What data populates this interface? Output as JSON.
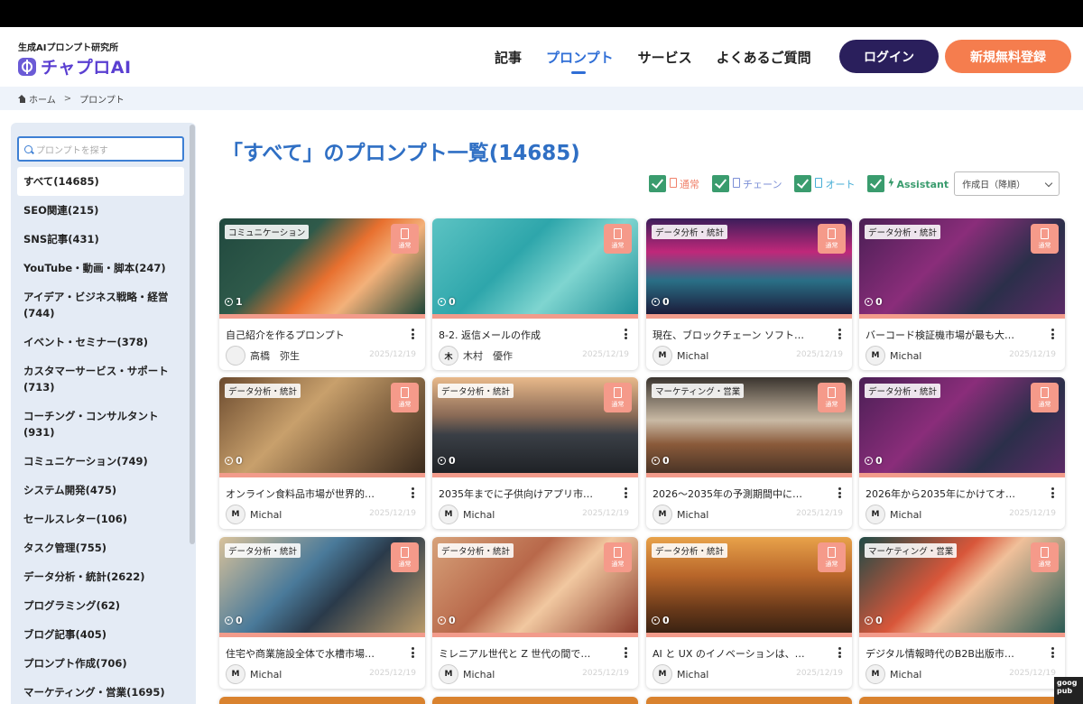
{
  "header": {
    "logo_sub": "生成AIプロンプト研究所",
    "logo_main": "チャプロAI",
    "nav": [
      "記事",
      "プロンプト",
      "サービス",
      "よくあるご質問"
    ],
    "nav_active_index": 1,
    "login_label": "ログイン",
    "register_label": "新規無料登録"
  },
  "breadcrumb": {
    "home": "ホーム",
    "separator": ">",
    "current": "プロンプト"
  },
  "sidebar": {
    "search_placeholder": "プロンプトを探す",
    "categories": [
      "すべて(14685)",
      "SEO関連(215)",
      "SNS記事(431)",
      "YouTube・動画・脚本(247)",
      "アイデア・ビジネス戦略・経営(744)",
      "イベント・セミナー(378)",
      "カスタマーサービス・サポート(713)",
      "コーチング・コンサルタント(931)",
      "コミュニケーション(749)",
      "システム開発(475)",
      "セールスレター(106)",
      "タスク管理(755)",
      "データ分析・統計(2622)",
      "プログラミング(62)",
      "ブログ記事(405)",
      "プロンプト作成(706)",
      "マーケティング・営業(1695)"
    ],
    "active_index": 0
  },
  "main": {
    "title": "「すべて」のプロンプト一覧(14685)",
    "filters": {
      "normal": "通常",
      "chain": "チェーン",
      "auto": "オート",
      "assistant": "Assistant",
      "sort_selected": "作成日（降順）"
    },
    "badge_label": "通常",
    "cards": [
      {
        "category": "コミュニケーション",
        "views": "1",
        "title": "自己紹介を作るプロンプト",
        "author": "高橋　弥生",
        "avatar": "",
        "date": "2025/12/19",
        "bg": "linear-gradient(135deg,#20483e 0%,#2f5a4a 35%,#e8702f 55%,#f3b17a 70%,#1f4537 100%)"
      },
      {
        "category": "",
        "views": "0",
        "title": "8-2. 返信メールの作成",
        "author": "木村　優作",
        "avatar": "木",
        "date": "2025/12/19",
        "bg": "linear-gradient(135deg,#5cc3c3 0%,#2ea6ab 40%,#7fd5d0 65%,#1f8f98 100%)"
      },
      {
        "category": "データ分析・統計",
        "views": "0",
        "title": "現在、ブロックチェーン ソフトウェ…",
        "author": "Michal",
        "avatar": "M",
        "date": "2025/12/19",
        "bg": "linear-gradient(180deg,#3b1d5a 0%,#c0287a 35%,#2a6f86 65%,#1b1b3a 100%)"
      },
      {
        "category": "データ分析・統計",
        "views": "0",
        "title": "バーコード検証機市場が最も大きな…",
        "author": "Michal",
        "avatar": "M",
        "date": "2025/12/19",
        "bg": "linear-gradient(135deg,#4a1f55 0%,#8a2d7a 40%,#2b2f4a 70%,#5b2a66 100%)"
      },
      {
        "category": "データ分析・統計",
        "views": "0",
        "title": "オンライン食料品市場が世界的に日…",
        "author": "Michal",
        "avatar": "M",
        "date": "2025/12/19",
        "bg": "linear-gradient(135deg,#6b4a2e 0%,#c8a06c 40%,#8a6a46 65%,#3a2a1c 100%)"
      },
      {
        "category": "データ分析・統計",
        "views": "0",
        "title": "2035年までに子供向けアプリ市場…",
        "author": "Michal",
        "avatar": "M",
        "date": "2025/12/19",
        "bg": "linear-gradient(180deg,#e8b98a 0%,#8a6a56 40%,#3a3f46 60%,#1f2226 100%)"
      },
      {
        "category": "マーケティング・営業",
        "views": "0",
        "title": "2026〜2035年の予測期間中に高級…",
        "author": "Michal",
        "avatar": "M",
        "date": "2025/12/19",
        "bg": "linear-gradient(180deg,#3a342e 0%,#c9b9a4 45%,#8a5a3a 70%,#4a3426 100%)"
      },
      {
        "category": "データ分析・統計",
        "views": "0",
        "title": "2026年から2035年にかけてオンラ…",
        "author": "Michal",
        "avatar": "M",
        "date": "2025/12/19",
        "bg": "linear-gradient(135deg,#4a1f55 0%,#8a2d7a 40%,#2b2f4a 70%,#5b2a66 100%)"
      },
      {
        "category": "データ分析・統計",
        "views": "0",
        "title": "住宅や商業施設全体で水槽市場が急…",
        "author": "Michal",
        "avatar": "M",
        "date": "2025/12/19",
        "bg": "linear-gradient(135deg,#d9c29a 0%,#4a7a9a 40%,#2a3a4a 60%,#b89a6a 100%)"
      },
      {
        "category": "データ分析・統計",
        "views": "0",
        "title": "ミレニアル世代と Z 世代の間でキャ…",
        "author": "Michal",
        "avatar": "M",
        "date": "2025/12/19",
        "bg": "linear-gradient(135deg,#d7a27a 0%,#b8684a 40%,#f1c8a0 60%,#8a3a2a 100%)"
      },
      {
        "category": "データ分析・統計",
        "views": "0",
        "title": "AI と UX のイノベーションは、ユー…",
        "author": "Michal",
        "avatar": "M",
        "date": "2025/12/19",
        "bg": "linear-gradient(180deg,#e8a24a 0%,#b8662a 40%,#6a3a1a 75%,#3a2212 100%)"
      },
      {
        "category": "マーケティング・営業",
        "views": "0",
        "title": "デジタル情報時代のB2B出版市場は…",
        "author": "Michal",
        "avatar": "M",
        "date": "2025/12/19",
        "bg": "linear-gradient(135deg,#1f4a46 0%,#d8563a 40%,#f0c09a 55%,#2a5a54 100%)"
      }
    ]
  },
  "ad_text": "goog pub"
}
